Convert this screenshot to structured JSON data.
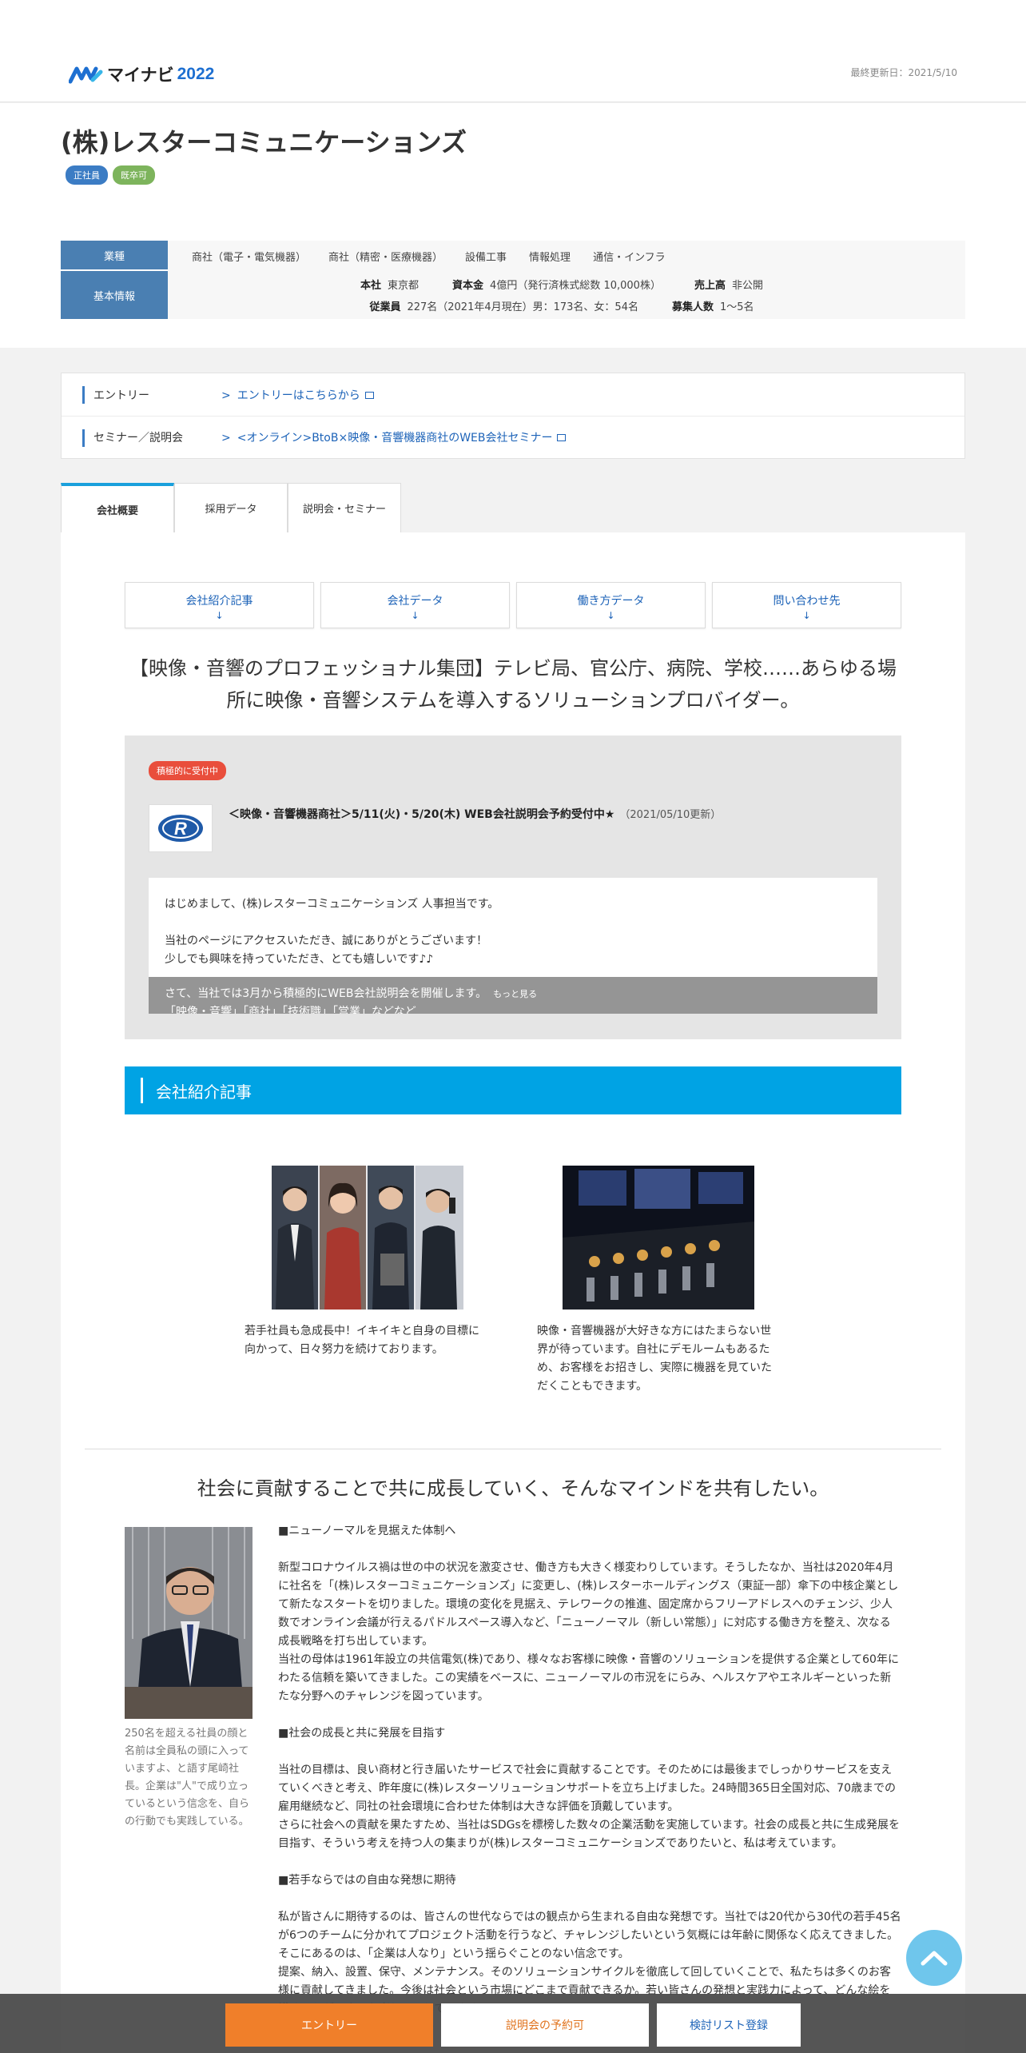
{
  "header": {
    "logo_text": "マイナビ",
    "logo_year": "2022",
    "last_update": "最終更新日：2021/5/10"
  },
  "company": {
    "name": "(株)レスターコミュニケーションズ",
    "badges": [
      "正社員",
      "既卒可"
    ]
  },
  "info": {
    "industry_label": "業種",
    "industries": [
      "商社（電子・電気機器）",
      "商社（精密・医療機器）",
      "設備工事",
      "情報処理",
      "通信・インフラ"
    ],
    "basic_label": "基本情報",
    "hq_k": "本社",
    "hq_v": "東京都",
    "capital_k": "資本金",
    "capital_v": "4億円（発行済株式総数 10,000株）",
    "sales_k": "売上高",
    "sales_v": "非公開",
    "employees_k": "従業員",
    "employees_v": "227名（2021年4月現在）男：173名、女：54名",
    "recruit_k": "募集人数",
    "recruit_v": "1～5名"
  },
  "entry": {
    "entry_label": "エントリー",
    "entry_link": "エントリーはこちらから",
    "seminar_label": "セミナー／説明会",
    "seminar_link": "<オンライン>BtoB×映像・音響機器商社のWEB会社セミナー"
  },
  "tabs": [
    "会社概要",
    "採用データ",
    "説明会・セミナー"
  ],
  "anchors": [
    "会社紹介記事",
    "会社データ",
    "働き方データ",
    "問い合わせ先"
  ],
  "anchor_arrow": "↓",
  "lead": "【映像・音響のプロフェッショナル集団】テレビ局、官公庁、病院、学校……あらゆる場所に映像・音響システムを導入するソリューションプロバイダー。",
  "news": {
    "tag": "積極的に受付中",
    "title": "＜映像・音響機器商社＞5/11(火)・5/20(木) WEB会社説明会予約受付中★",
    "date": "（2021/05/10更新）",
    "body": "はじめまして、(株)レスターコミュニケーションズ 人事担当です。\n\n当社のページにアクセスいただき、誠にありがとうございます！\n少しでも興味を持っていただき、とても嬉しいです♪♪",
    "overlay_text": "さて、当社では3月から積極的にWEB会社説明会を開催します。",
    "overlay_more": "もっと見る",
    "overlay_next": "「映像・音響」「商社」「技術職」「営業」などなど"
  },
  "section_title": "会社紹介記事",
  "photos": {
    "cap1": "若手社員も急成長中！イキイキと自身の目標に向かって、日々努力を続けております。",
    "cap2": "映像・音響機器が大好きな方にはたまらない世界が待っています。自社にデモルームもあるため、お客様をお招きし、実際に機器を見ていただくこともできます。"
  },
  "mind": "社会に貢献することで共に成長していく、そんなマインドを共有したい。",
  "ceo_caption": "250名を超える社員の顔と名前は全員私の頭に入っていますよ、と語す尾崎社長。企業は\"人\"で成り立っているという信念を、自らの行動でも実践している。",
  "article": {
    "h1": "■ニューノーマルを見据えた体制へ",
    "p1": "新型コロナウイルス禍は世の中の状況を激変させ、働き方も大きく様変わりしています。そうしたなか、当社は2020年4月に社名を「(株)レスターコミュニケーションズ」に変更し、(株)レスターホールディングス（東証一部）傘下の中核企業として新たなスタートを切りました。環境の変化を見据え、テレワークの推進、固定席からフリーアドレスへのチェンジ、少人数でオンライン会議が行えるパドルスペース導入など、「ニューノーマル（新しい常態）」に対応する働き方を整え、次なる成長戦略を打ち出しています。\n当社の母体は1961年設立の共信電気(株)であり、様々なお客様に映像・音響のソリューションを提供する企業として60年にわたる信頼を築いてきました。この実績をベースに、ニューノーマルの市況をにらみ、ヘルスケアやエネルギーといった新たな分野へのチャレンジを図っています。",
    "h2": "■社会の成長と共に発展を目指す",
    "p2": "当社の目標は、良い商材と行き届いたサービスで社会に貢献することです。そのためには最後までしっかりサービスを支えていくべきと考え、昨年度に(株)レスターソリューションサポートを立ち上げました。24時間365日全国対応、70歳までの雇用継続など、同社の社会環境に合わせた体制は大きな評価を頂戴しています。\nさらに社会への貢献を果たすため、当社はSDGsを標榜した数々の企業活動を実施しています。社会の成長と共に生成発展を目指す、そういう考えを持つ人の集まりが(株)レスターコミュニケーションズでありたいと、私は考えています。",
    "h3": "■若手ならではの自由な発想に期待",
    "p3": "私が皆さんに期待するのは、皆さんの世代ならではの観点から生まれる自由な発想です。当社では20代から30代の若手45名が6つのチームに分かれてプロジェクト活動を行うなど、チャレンジしたいという気概には年齢に関係なく応えてきました。そこにあるのは、「企業は人なり」という揺らぐことのない信念です。\n提案、納入、設置、保守、メンテナンス。そのソリューションサイクルを徹底して回していくことで、私たちは多くのお客様に貢献してきました。今後は社会という市場にどこまで貢献できるか。若い皆さんの発想と実践力によって、どんな絵を描くことができるか楽しみにしています。\n＜代表取締役社長　尾崎　聖＞"
  },
  "bottom": {
    "entry": "エントリー",
    "seminar": "説明会の予約可",
    "list": "検討リスト登録"
  },
  "colors": {
    "accent": "#00a3e4",
    "label_bg": "#4a7fb2",
    "entry_orange": "#f07f2a",
    "tag_red": "#e94e3c"
  }
}
